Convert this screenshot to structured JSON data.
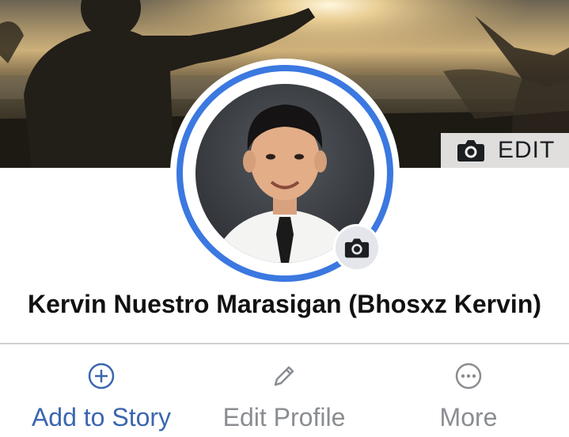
{
  "cover": {
    "edit_label": "EDIT",
    "edit_icon": "camera-icon"
  },
  "profile": {
    "name": "Kervin Nuestro Marasigan (Bhosxz Kervin)",
    "avatar_camera_icon": "camera-icon",
    "ring_color": "#3b78e0"
  },
  "actions": [
    {
      "label": "Add to Story",
      "icon": "plus-circle-icon",
      "color": "#3b66b0"
    },
    {
      "label": "Edit Profile",
      "icon": "pencil-icon",
      "color": "#8a8d91"
    },
    {
      "label": "More",
      "icon": "more-dots-icon",
      "color": "#8a8d91"
    }
  ]
}
